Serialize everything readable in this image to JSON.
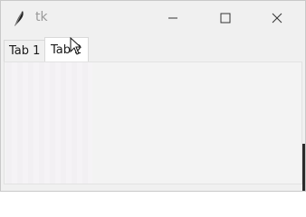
{
  "window": {
    "title": "tk",
    "controls": {
      "minimize_icon": "minimize-icon",
      "maximize_icon": "maximize-icon",
      "close_icon": "close-icon"
    }
  },
  "notebook": {
    "tabs": [
      {
        "label": "Tab 1",
        "selected": false
      },
      {
        "label": "Tab 2",
        "selected": true
      }
    ]
  },
  "colors": {
    "chrome": "#f0f0f0",
    "selected_tab": "#ffffff",
    "text": "#1a1a1a",
    "title_text": "#999999"
  }
}
